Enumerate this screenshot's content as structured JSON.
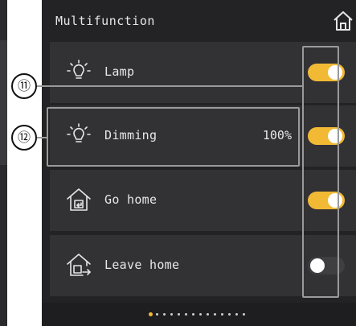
{
  "header": {
    "title": "Multifunction",
    "home_icon": "home-icon"
  },
  "rows": [
    {
      "label": "Lamp",
      "value": "",
      "icon": "bulb-icon",
      "toggle": "on"
    },
    {
      "label": "Dimming",
      "value": "100%",
      "icon": "bulb-icon",
      "toggle": "on"
    },
    {
      "label": "Go home",
      "icon": "go-home-icon",
      "toggle": "on"
    },
    {
      "label": "Leave home",
      "icon": "leave-home-icon",
      "toggle": "off"
    }
  ],
  "pager": {
    "total_pages": 14,
    "current_page": 1
  },
  "annotations": {
    "callout_11": "⑪",
    "callout_12": "⑫"
  },
  "colors": {
    "accent": "#f2b934",
    "panel": "#232325",
    "row": "#323235",
    "text": "#e8e8e8"
  }
}
